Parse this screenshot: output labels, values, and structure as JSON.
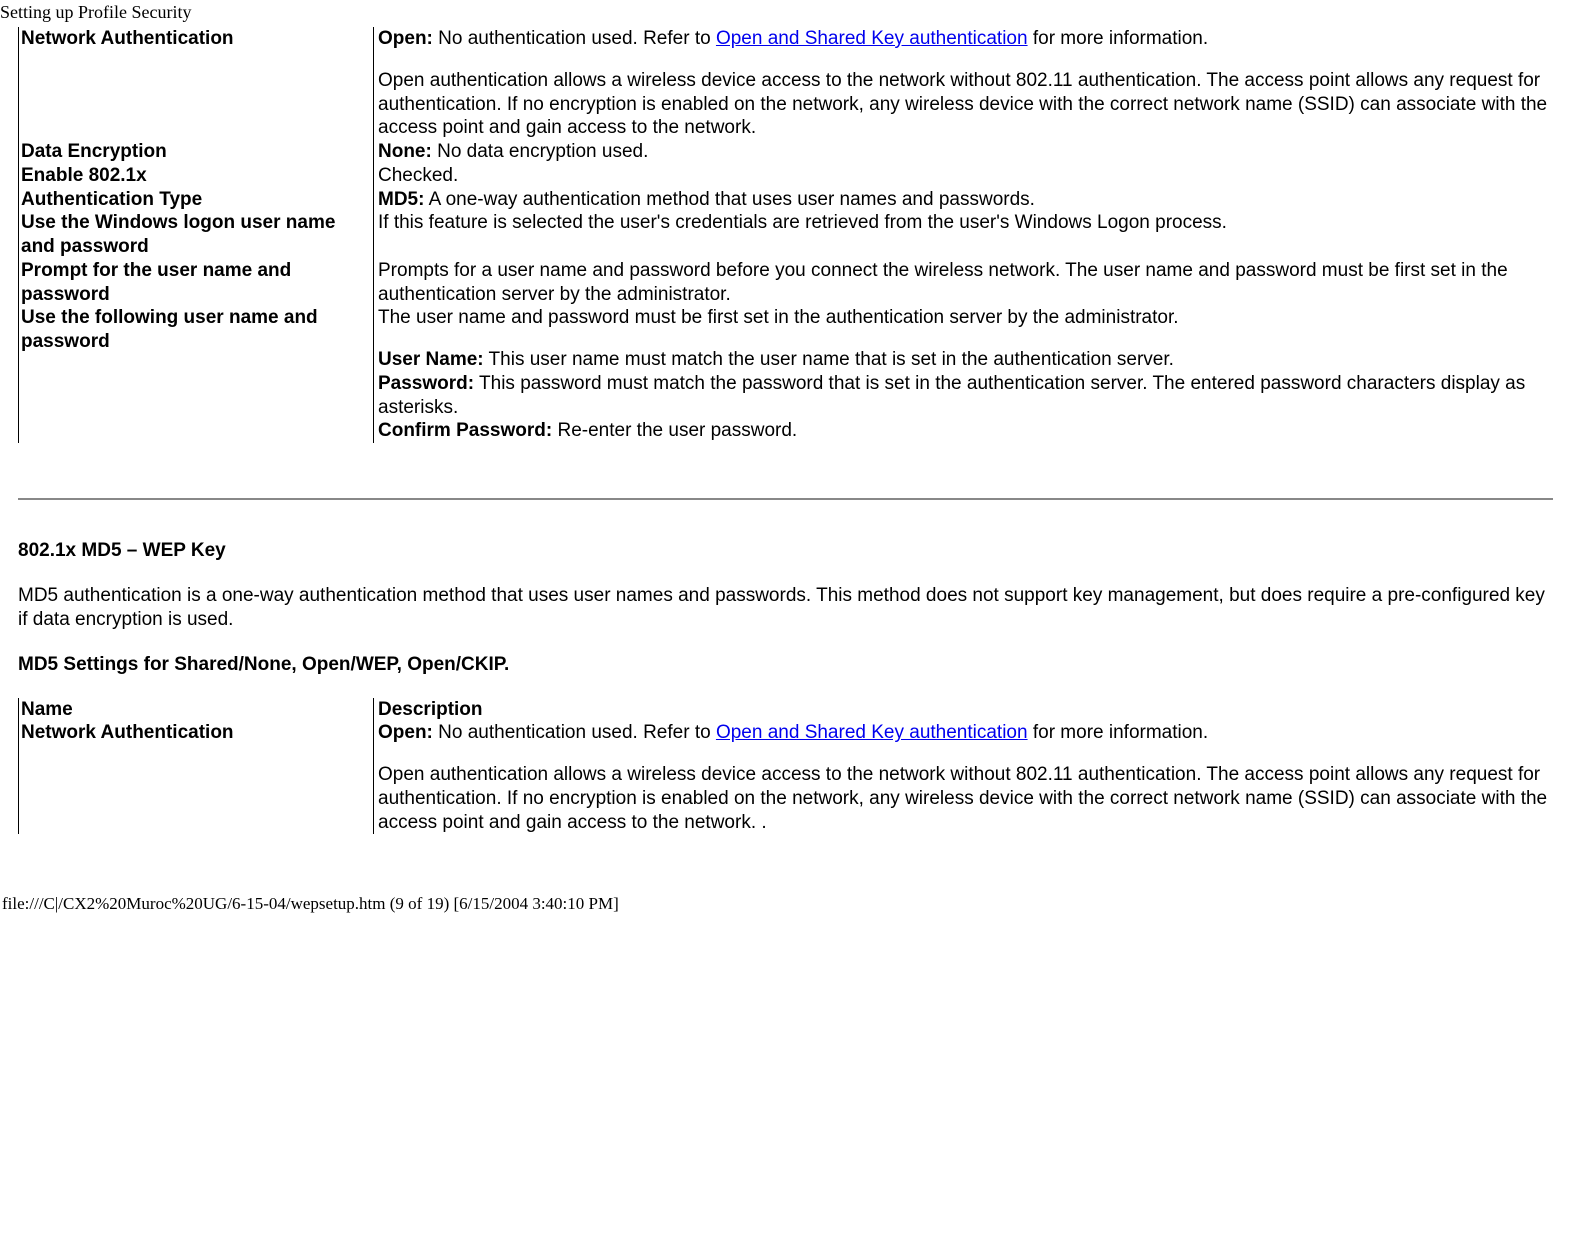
{
  "page_title": "Setting up Profile Security",
  "table1": {
    "rows": [
      {
        "name": "Network Authentication",
        "desc_parts": [
          {
            "bold": "Open:",
            "text": " No authentication used. Refer to "
          },
          {
            "link": "Open and Shared Key authentication"
          },
          {
            "text": " for more information."
          }
        ],
        "desc_para2": "Open authentication allows a wireless device access to the network without 802.11 authentication. The access point allows any request for authentication. If no encryption is enabled on the network, any wireless device with the correct network name (SSID) can associate with the access point and gain access to the network."
      },
      {
        "name": "Data Encryption",
        "desc_parts": [
          {
            "bold": "None:",
            "text": " No data encryption used."
          }
        ]
      },
      {
        "name": "Enable 802.1x",
        "desc_parts": [
          {
            "text": "Checked."
          }
        ]
      },
      {
        "name": "Authentication Type",
        "desc_parts": [
          {
            "bold": "MD5:",
            "text": " A one-way authentication method that uses user names and passwords."
          }
        ]
      },
      {
        "name": "Use the Windows logon user name and password",
        "desc_parts": [
          {
            "text": "If this feature is selected the user's credentials are retrieved from the user's Windows Logon process."
          }
        ]
      },
      {
        "name": "Prompt for the user name and password",
        "desc_parts": [
          {
            "text": "Prompts for a user name and password before you connect the wireless network. The user name and password must be first set in the authentication server by the administrator."
          }
        ]
      },
      {
        "name": "Use the following user name and password",
        "desc_parts": [
          {
            "text": "The user name and password must be first set in the authentication server by the administrator."
          }
        ],
        "extra_lines": [
          {
            "bold": "User Name:",
            "text": " This user name must match the user name that is set in the authentication server."
          },
          {
            "bold": "Password:",
            "text": " This password must match the password that is set in the authentication server. The entered password characters display as asterisks."
          },
          {
            "bold": "Confirm Password:",
            "text": " Re-enter the user password."
          }
        ]
      }
    ]
  },
  "section2": {
    "heading": "802.1x MD5 – WEP Key",
    "para": "MD5 authentication is a one-way authentication method that uses user names and passwords. This method does not support key management, but does require a pre-configured key if data encryption is used.",
    "subheading": "MD5 Settings for Shared/None, Open/WEP, Open/CKIP."
  },
  "table2": {
    "header": {
      "name": "Name",
      "desc": "Description"
    },
    "rows": [
      {
        "name": "Network Authentication",
        "desc_parts": [
          {
            "bold": "Open:",
            "text": " No authentication used. Refer to "
          },
          {
            "link": "Open and Shared Key authentication"
          },
          {
            "text": " for more information."
          }
        ],
        "desc_para2": "Open authentication allows a wireless device access to the network without 802.11 authentication. The access point allows any request for authentication. If no encryption is enabled on the network, any wireless device with the correct network name (SSID) can associate with the access point and gain access to the network.  ."
      }
    ]
  },
  "footer": "file:///C|/CX2%20Muroc%20UG/6-15-04/wepsetup.htm (9 of 19) [6/15/2004 3:40:10 PM]"
}
